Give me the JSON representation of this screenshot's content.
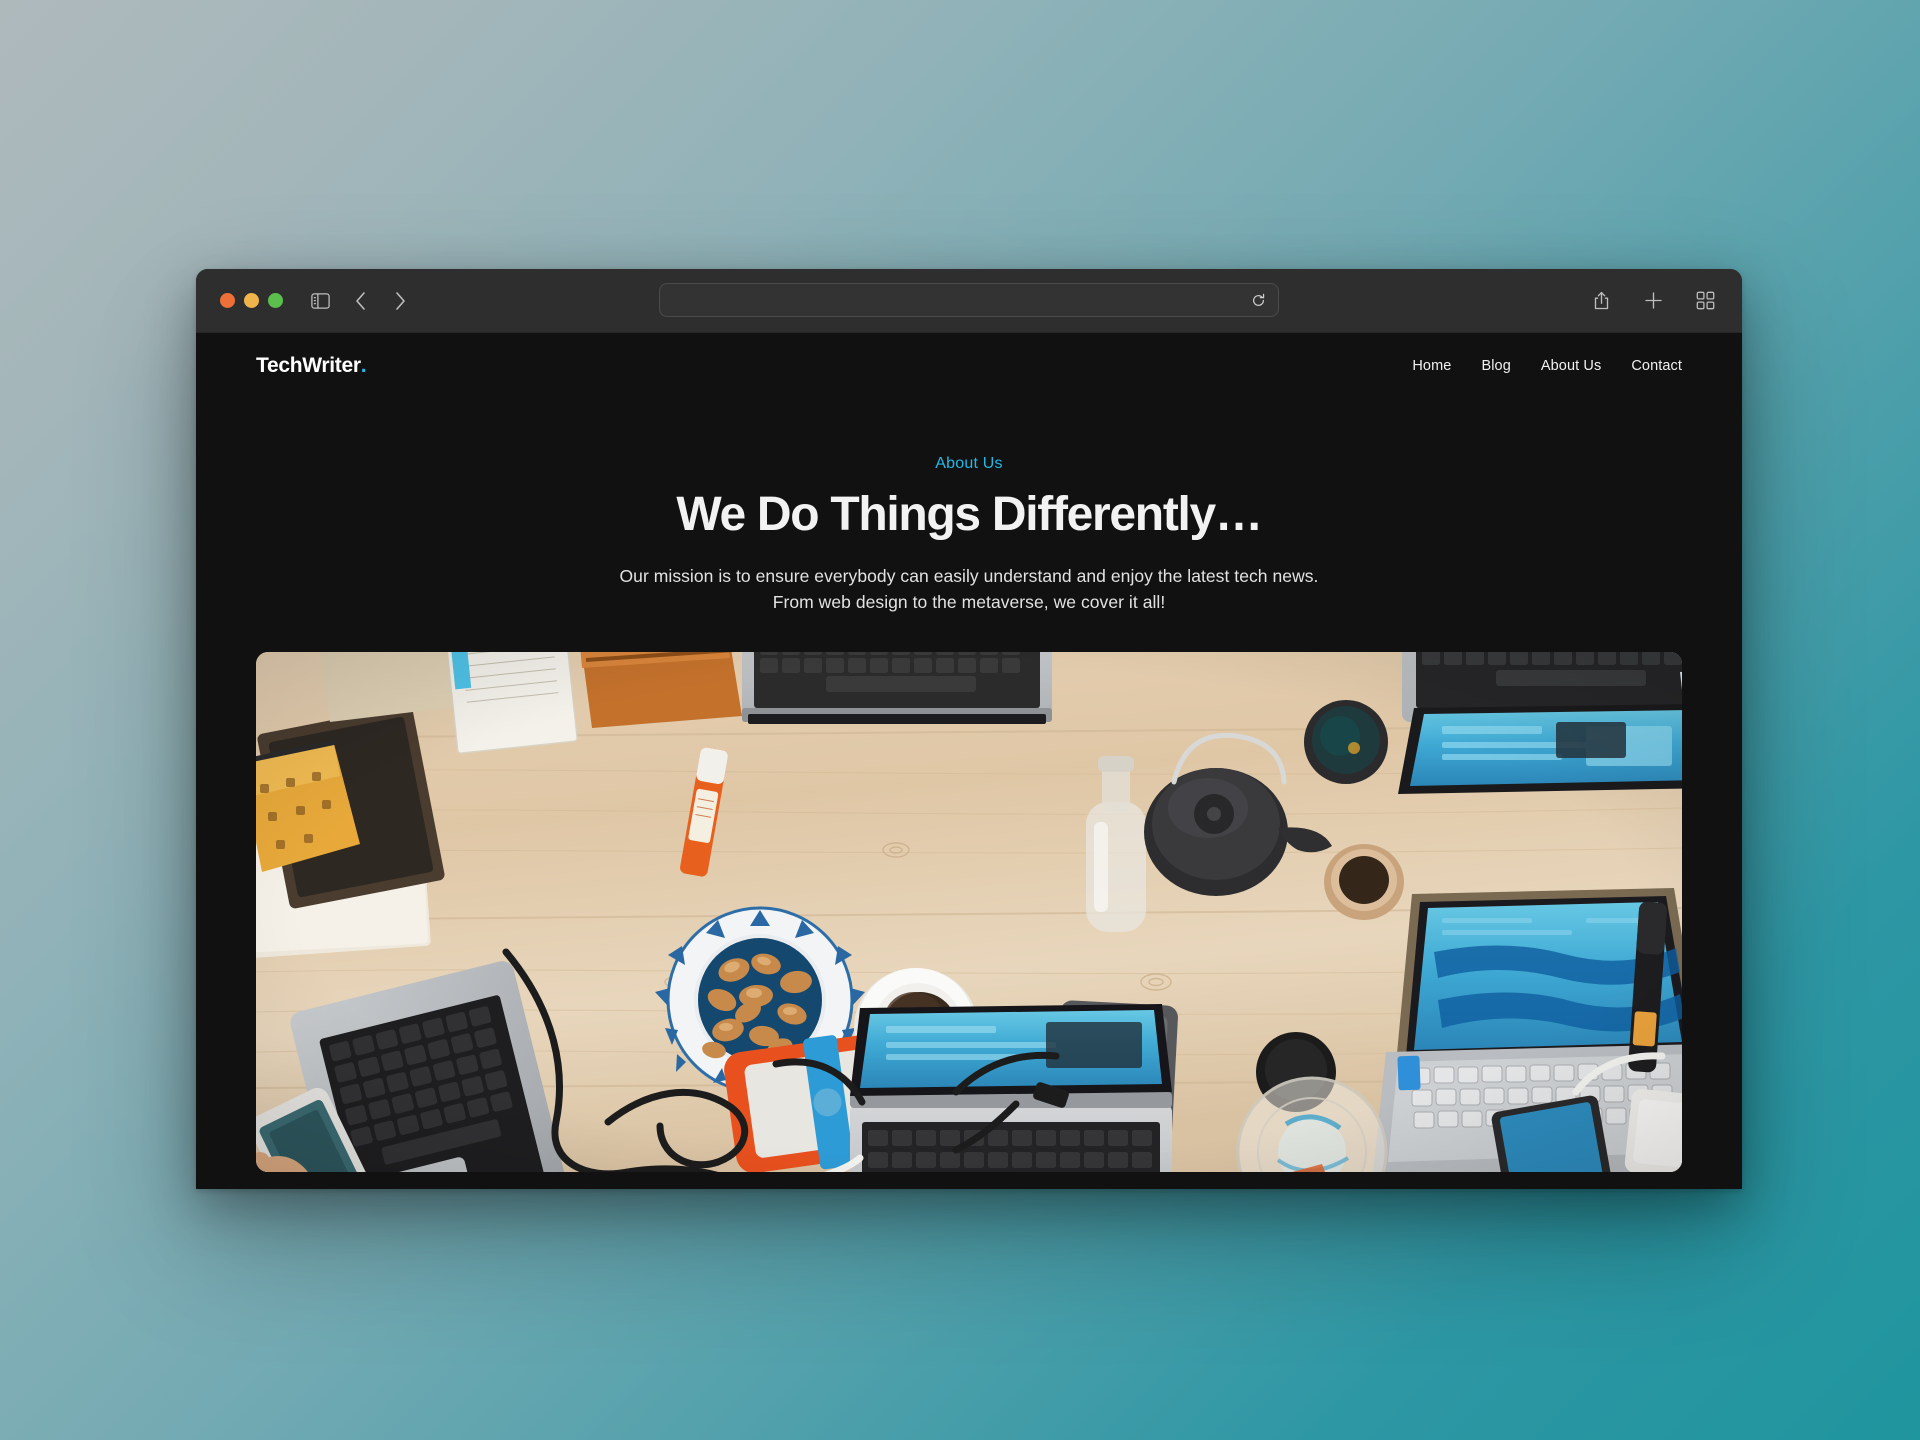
{
  "browser": {
    "traffic_lights": [
      {
        "name": "close",
        "color": "#ec7038"
      },
      {
        "name": "minimize",
        "color": "#efb54b"
      },
      {
        "name": "maximize",
        "color": "#5cbf4d"
      }
    ],
    "sidebar_toggle_icon": "sidebar-icon",
    "back_icon": "chevron-left-icon",
    "forward_icon": "chevron-right-icon",
    "address": {
      "value": "",
      "placeholder": "",
      "reload_icon": "reload-icon"
    },
    "share_icon": "share-icon",
    "new_tab_icon": "plus-icon",
    "tab_overview_icon": "tab-grid-icon"
  },
  "site": {
    "logo": {
      "text": "TechWriter",
      "dot": ".",
      "dot_color": "#22b8e6"
    },
    "nav": [
      {
        "label": "Home"
      },
      {
        "label": "Blog"
      },
      {
        "label": "About Us"
      },
      {
        "label": "Contact"
      }
    ],
    "hero": {
      "eyebrow": "About Us",
      "eyebrow_color": "#22b8e6",
      "title": "We Do Things Differently…",
      "paragraph": "Our mission is to ensure everybody can easily understand and enjoy the latest tech news. From web design to the metaverse, we cover it all!"
    },
    "photo": {
      "alt": "Overhead flat-lay of a light wooden desk covered with laptops, a smartphone, a bowl of nuts, coffee cups, a teapot, an orange portable hard drive, notebooks and cables",
      "background_color": "#111111"
    }
  },
  "desktop": {
    "background_gradient_from": "#aeb9bc",
    "background_gradient_to": "#1f959e"
  }
}
